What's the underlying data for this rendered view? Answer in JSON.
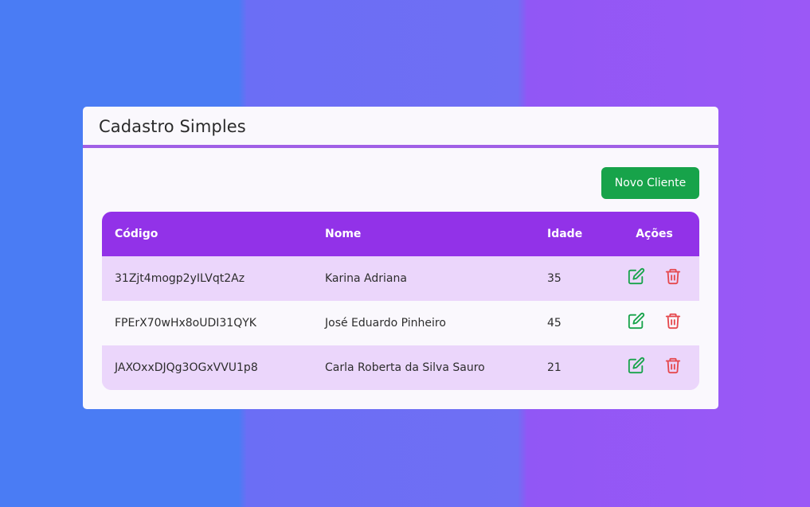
{
  "card": {
    "title": "Cadastro Simples"
  },
  "toolbar": {
    "new_client_label": "Novo Cliente"
  },
  "table": {
    "headers": {
      "code": "Código",
      "name": "Nome",
      "age": "Idade",
      "actions": "Ações"
    },
    "rows": [
      {
        "code": "31Zjt4mogp2yILVqt2Az",
        "name": "Karina Adriana",
        "age": "35"
      },
      {
        "code": "FPErX70wHx8oUDI31QYK",
        "name": "José Eduardo Pinheiro",
        "age": "45"
      },
      {
        "code": "JAXOxxDJQg3OGxVVU1p8",
        "name": "Carla Roberta da Silva Sauro",
        "age": "21"
      }
    ]
  },
  "icons": {
    "edit": "edit-icon",
    "delete": "trash-icon"
  },
  "colors": {
    "header_bg": "#9232e8",
    "accent_line": "#a060e6",
    "button_green": "#17a34a",
    "edit_green": "#17a34a",
    "delete_red": "#e5484d",
    "row_odd": "#ebd6fb"
  }
}
